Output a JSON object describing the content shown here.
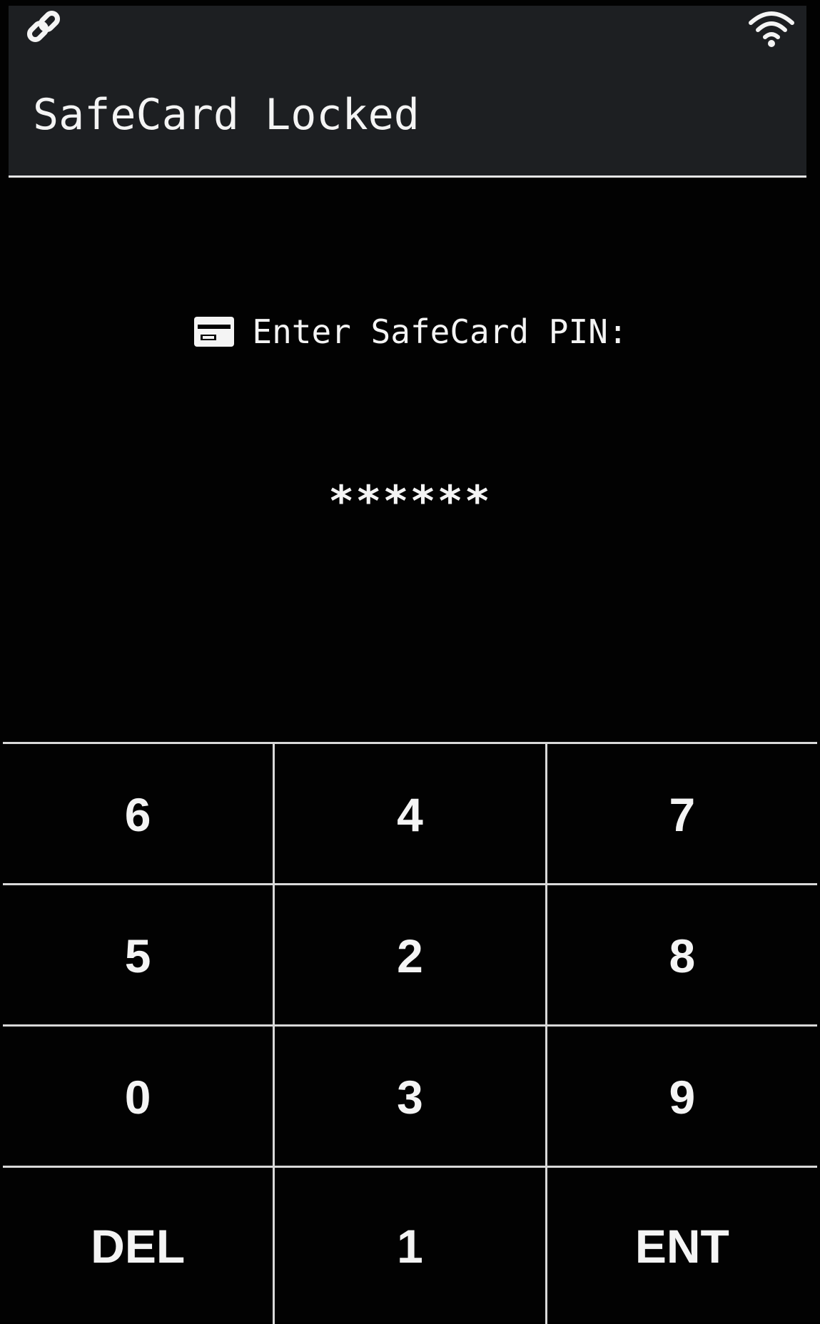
{
  "status_bar": {
    "left_icon": "link-icon",
    "right_icon": "wifi-icon"
  },
  "header": {
    "title": "SafeCard Locked"
  },
  "prompt": {
    "icon": "card-icon",
    "label": "Enter SafeCard PIN:"
  },
  "pin_field": {
    "value": "******"
  },
  "keypad": {
    "rows": [
      [
        "6",
        "4",
        "7"
      ],
      [
        "5",
        "2",
        "8"
      ],
      [
        "0",
        "3",
        "9"
      ],
      [
        "DEL",
        "1",
        "ENT"
      ]
    ]
  },
  "colors": {
    "background": "#020202",
    "header_background": "#1d1f22",
    "foreground": "#f4f4f4",
    "divider": "#d9d9d9"
  }
}
